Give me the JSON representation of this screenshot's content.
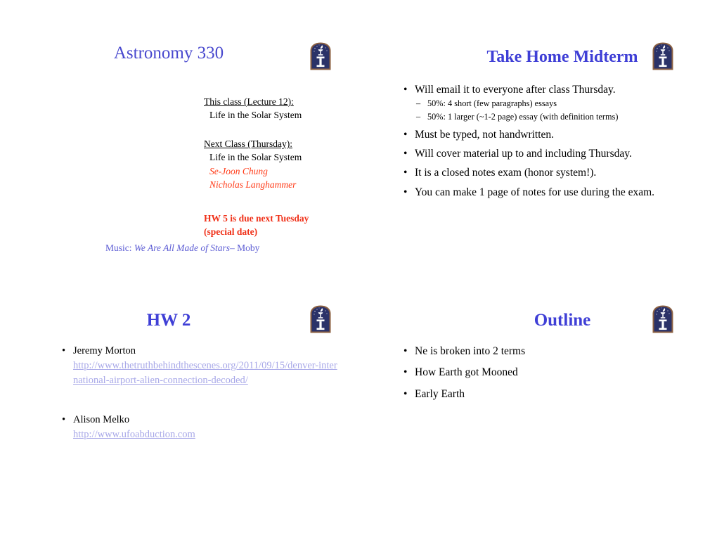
{
  "colors": {
    "title_blue": "#3F3FD6",
    "link_lavender": "#A8A8E8",
    "red": "#FF3B18",
    "music_blue": "#5D5DD4",
    "logo_navy": "#2B3268",
    "logo_border": "#8C6142"
  },
  "logo": {
    "name": "university-block-i-torch-logo",
    "letter": "I"
  },
  "slides": [
    {
      "id": "slide-1",
      "title": "Astronomy 330",
      "this_class_header": "This class (Lecture 12):",
      "this_class_topic": "Life in the Solar System",
      "next_class_header": "Next Class (Thursday):",
      "next_class_topic": "Life in the Solar System",
      "presenters": [
        "Se-Joon Chung",
        "Nicholas Langhammer"
      ],
      "hw_note_line1": "HW 5 is due next Tuesday",
      "hw_note_line2": "(special date)",
      "music_prefix": "Music: ",
      "music_title": "We Are All Made of Stars",
      "music_artist": "– Moby"
    },
    {
      "id": "slide-2",
      "title": "Take Home Midterm",
      "bullets": [
        {
          "text": "Will email it to everyone after class Thursday.",
          "sub": [
            "50%: 4 short (few paragraphs) essays",
            "50%: 1 larger (~1-2 page) essay (with definition terms)"
          ]
        },
        {
          "text": "Must be typed, not handwritten.",
          "sub": []
        },
        {
          "text": "Will cover material up to and including Thursday.",
          "sub": []
        },
        {
          "text": "It is a closed notes exam (honor system!).",
          "sub": []
        },
        {
          "text": "You can make 1 page of notes for use during the exam.",
          "sub": []
        }
      ]
    },
    {
      "id": "slide-3",
      "title": "HW 2",
      "entries": [
        {
          "name": "Jeremy Morton",
          "url": "http://www.thetruthbehindthescenes.org/2011/09/15/denver-international-airport-alien-connection-decoded/"
        },
        {
          "name": "Alison Melko",
          "url": "http://www.ufoabduction.com"
        }
      ]
    },
    {
      "id": "slide-4",
      "title": "Outline",
      "bullets": [
        "Ne is broken into 2 terms",
        "How Earth got Mooned",
        "Early Earth"
      ]
    }
  ],
  "glyphs": {
    "bullet": "•",
    "dash": "–"
  }
}
